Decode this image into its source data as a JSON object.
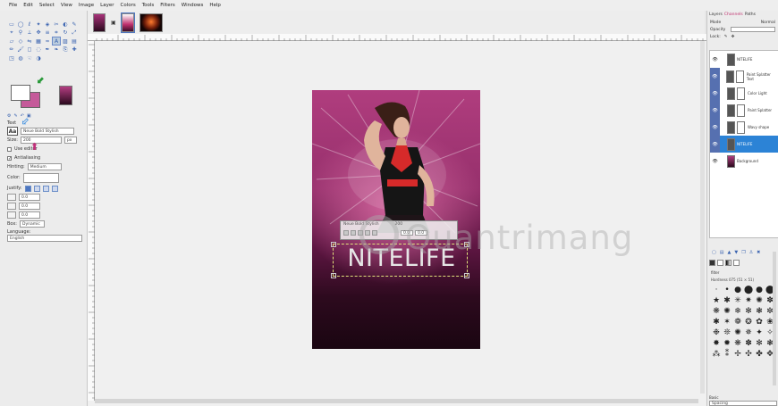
{
  "menubar": {
    "items": [
      "File",
      "Edit",
      "Select",
      "View",
      "Image",
      "Layer",
      "Colors",
      "Tools",
      "Filters",
      "Windows",
      "Help"
    ]
  },
  "toolbox": {
    "tool_icons": [
      "rect-select-icon",
      "ellipse-select-icon",
      "free-select-icon",
      "fuzzy-select-icon",
      "color-select-icon",
      "scissors-icon",
      "foreground-select-icon",
      "paths-icon",
      "color-picker-icon",
      "zoom-icon",
      "measure-icon",
      "move-icon",
      "align-icon",
      "crop-icon",
      "rotate-icon",
      "scale-icon",
      "shear-icon",
      "perspective-icon",
      "flip-icon",
      "cage-icon",
      "warp-icon",
      "text-icon",
      "bucket-fill-icon",
      "gradient-icon",
      "pencil-icon",
      "paintbrush-icon",
      "eraser-icon",
      "airbrush-icon",
      "ink-icon",
      "mypaint-icon",
      "clone-icon",
      "heal-icon",
      "perspective-clone-icon",
      "blur-icon",
      "smudge-icon",
      "dodge-icon"
    ],
    "tool_glyphs": [
      "▭",
      "◯",
      "ℓ",
      "✦",
      "◈",
      "✂",
      "◐",
      "✎",
      "⌖",
      "⚲",
      "⟂",
      "✥",
      "≡",
      "⌗",
      "↻",
      "⤢",
      "▱",
      "◇",
      "⇋",
      "▦",
      "≈",
      "A",
      "▨",
      "▤",
      "✏",
      "🖌",
      "◻",
      "◌",
      "✒",
      "❧",
      "⎘",
      "✚",
      "◳",
      "◍",
      "☜",
      "◑"
    ],
    "selected_tool_index": 21,
    "foreground_color": "#ffffff",
    "background_color": "#c55a9a"
  },
  "tool_options": {
    "title": "Text",
    "font_tooltip": "Neue Bold Stylish",
    "size_label": "Size:",
    "size_value": "200",
    "size_unit": "px",
    "use_editor_label": "Use editor",
    "antialiasing_label": "Antialiasing",
    "hinting_label": "Hinting:",
    "hinting_value": "Medium",
    "color_label": "Color:",
    "justify_label": "Justify:",
    "indent_value": "0.0",
    "line_spacing_value": "0.0",
    "letter_spacing_value": "0.0",
    "box_label": "Box:",
    "box_value": "Dynamic",
    "language_label": "Language:",
    "language_value": "English"
  },
  "annotations": {
    "arrow_green_color": "#2a9a3a",
    "arrow_blue_color": "#3c8ee0",
    "arrow_magenta_color": "#c0307a"
  },
  "canvas": {
    "poster_text": "NITELIFE",
    "text_toolbox_title": "Neue Bold Stylish",
    "text_toolbox_size": "200",
    "text_toolbox_val1": "0.0",
    "text_toolbox_val2": "0.0",
    "watermark_text": "Quantrimang"
  },
  "layers_dock": {
    "tabs": [
      "Layers",
      "Channels",
      "Paths"
    ],
    "mode_label": "Mode",
    "mode_value": "Normal",
    "opacity_label": "Opacity",
    "lock_label": "Lock:",
    "layers": [
      {
        "name": "NITELIFE",
        "visible": true,
        "selected": false
      },
      {
        "name": "Paint Splatter Text",
        "visible": true,
        "selected": false
      },
      {
        "name": "Color Light",
        "visible": true,
        "selected": false
      },
      {
        "name": "Paint Splatter",
        "visible": true,
        "selected": false
      },
      {
        "name": "Wavy shape",
        "visible": true,
        "selected": false
      },
      {
        "name": "NITELIFE",
        "visible": true,
        "selected": true
      },
      {
        "name": "Background",
        "visible": true,
        "selected": false
      }
    ]
  },
  "brushes_dock": {
    "filter_label": "filter",
    "current_brush": "Hardness 075 (51 × 51)",
    "brush_glyphs": [
      "·",
      "•",
      "●",
      "⬤",
      "●",
      "⬤",
      "★",
      "✱",
      "✳",
      "✷",
      "✺",
      "✽",
      "❋",
      "✺",
      "❄",
      "✻",
      "❃",
      "✼",
      "✱",
      "✶",
      "❁",
      "❂",
      "✿",
      "❀",
      "❉",
      "❊",
      "✺",
      "✵",
      "✦",
      "✧",
      "✸",
      "✹",
      "❋",
      "✽",
      "✻",
      "❃",
      "⁂",
      "⁑",
      "✢",
      "✣",
      "✤",
      "✥"
    ],
    "tags_label": "Basic",
    "spacing_label": "Spacing"
  }
}
